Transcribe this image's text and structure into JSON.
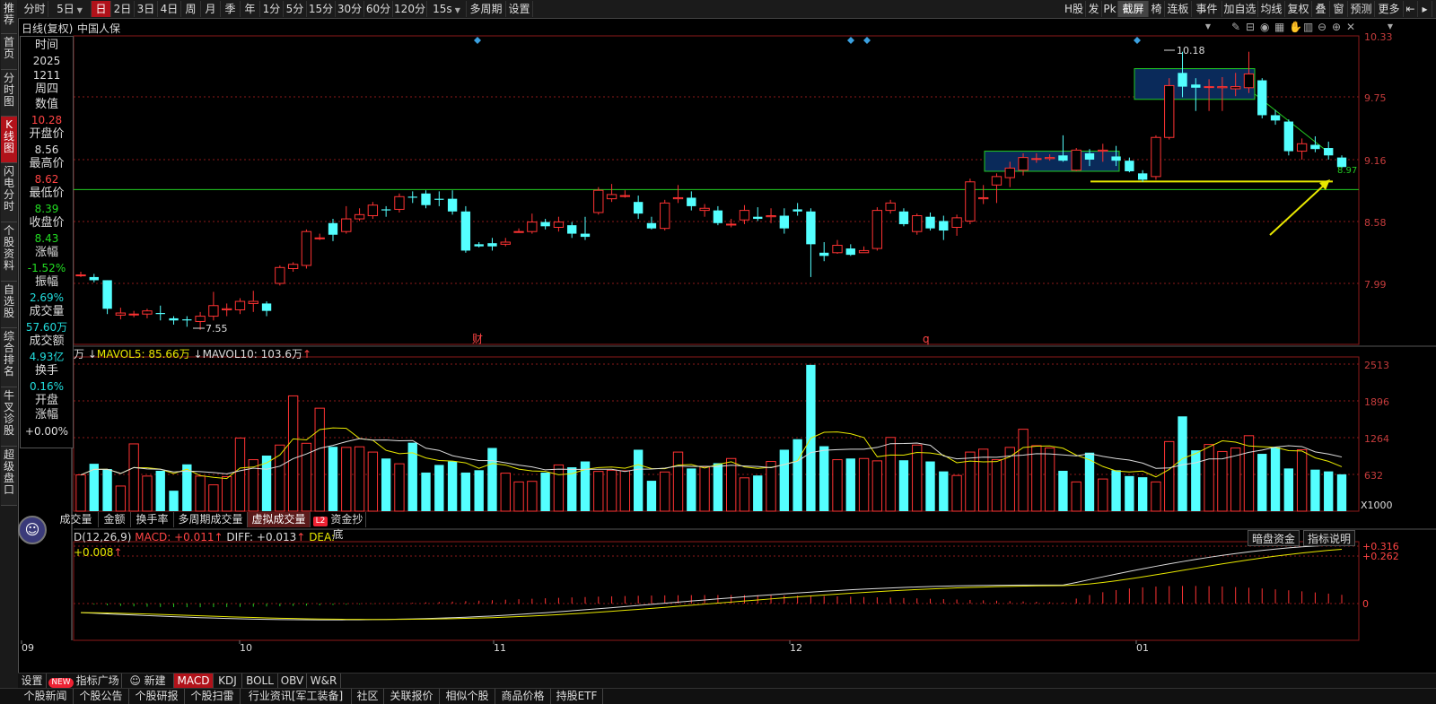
{
  "leftnav": [
    {
      "label": "推荐",
      "h": 38
    },
    {
      "label": "首页",
      "h": 40
    },
    {
      "label": "分时图",
      "h": 52
    },
    {
      "label": "K线图",
      "h": 52,
      "active": true
    },
    {
      "label": "闪电分时",
      "h": 66
    },
    {
      "label": "个股资料",
      "h": 66
    },
    {
      "label": "自选股",
      "h": 52
    },
    {
      "label": "综合排名",
      "h": 66
    },
    {
      "label": "牛叉诊股",
      "h": 66
    },
    {
      "label": "超级盘口",
      "h": 66
    }
  ],
  "toolbar": {
    "left": [
      {
        "label": "分时",
        "w": 30
      },
      {
        "label": "5日",
        "w": 48,
        "dropdown": true
      },
      {
        "label": "日",
        "w": 22,
        "selected": true
      },
      {
        "label": "2日",
        "w": 26
      },
      {
        "label": "3日",
        "w": 26
      },
      {
        "label": "4日",
        "w": 26
      },
      {
        "label": "周",
        "w": 22
      },
      {
        "label": "月",
        "w": 22
      },
      {
        "label": "季",
        "w": 22
      },
      {
        "label": "年",
        "w": 22
      },
      {
        "label": "1分",
        "w": 26
      },
      {
        "label": "5分",
        "w": 26
      },
      {
        "label": "15分",
        "w": 32
      },
      {
        "label": "30分",
        "w": 32
      },
      {
        "label": "60分",
        "w": 32
      },
      {
        "label": "120分",
        "w": 38
      },
      {
        "label": "15s",
        "w": 44,
        "dropdown": true
      },
      {
        "label": "多周期",
        "w": 44
      },
      {
        "label": "设置",
        "w": 30
      }
    ],
    "right": [
      {
        "label": "H股",
        "w": 26
      },
      {
        "label": "发",
        "w": 18
      },
      {
        "label": "Pk",
        "w": 18
      },
      {
        "label": "截屏",
        "w": 34,
        "dark": true
      },
      {
        "label": "椅",
        "w": 18
      },
      {
        "label": "连板",
        "w": 30
      },
      {
        "label": "事件",
        "w": 34,
        "dropdown": true
      },
      {
        "label": "加自选",
        "w": 40
      },
      {
        "label": "均线",
        "w": 30
      },
      {
        "label": "复权",
        "w": 30
      },
      {
        "label": "叠",
        "w": 20
      },
      {
        "label": "窗",
        "w": 20
      },
      {
        "label": "预测",
        "w": 30
      },
      {
        "label": "更多",
        "w": 32,
        "dropdown": true
      },
      {
        "label": "",
        "w": 16,
        "icon": "prev-icon"
      },
      {
        "label": "",
        "w": 16,
        "icon": "next-icon"
      }
    ]
  },
  "header": {
    "kline_type": "日线(复权)",
    "stock_name": "中国人保"
  },
  "data_panel": {
    "time_label": "时间",
    "time_year": "2025",
    "time_md": "1211",
    "weekday": "周四",
    "value_label": "数值",
    "value": "10.28",
    "open_label": "开盘价",
    "open": "8.56",
    "high_label": "最高价",
    "high": "8.62",
    "low_label": "最低价",
    "low": "8.39",
    "close_label": "收盘价",
    "close": "8.43",
    "change_label": "涨幅",
    "change": "-1.52%",
    "amplitude_label": "振幅",
    "amplitude": "2.69%",
    "volume_label": "成交量",
    "volume": "57.60万",
    "amount_label": "成交额",
    "amount": "4.93亿",
    "turnover_label": "换手",
    "turnover": "0.16%",
    "open_change_label_1": "开盘",
    "open_change_label_2": "涨幅",
    "open_change": "+0.00%"
  },
  "price_axis": [
    "10.33",
    "9.75",
    "9.16",
    "8.58",
    "7.99"
  ],
  "volume_axis": [
    "2513",
    "1896",
    "1264",
    "632"
  ],
  "volume_unit": "X1000",
  "macd_axis": [
    "+0.316",
    "+0.262",
    "0"
  ],
  "date_labels": [
    "09",
    "10",
    "11",
    "12",
    "01"
  ],
  "annotations": {
    "high": "10.18",
    "low": "7.55",
    "current": "8.97",
    "event_1": "财",
    "event_2": "q"
  },
  "volume_legend": {
    "prefix": "万",
    "mavol5": "MAVOL5: 85.66万",
    "mavol10": "MAVOL10: 103.6万"
  },
  "volume_tabs": [
    {
      "label": "成交量",
      "w": 50
    },
    {
      "label": "金额",
      "w": 36
    },
    {
      "label": "换手率",
      "w": 48
    },
    {
      "label": "多周期成交量",
      "w": 82
    },
    {
      "label": "虚拟成交量",
      "w": 70,
      "selected": true
    },
    {
      "label": "资金抄底",
      "w": 62,
      "badge": "L2"
    }
  ],
  "macd_legend": {
    "name": "D(12,26,9)",
    "macd": "MACD: +0.011",
    "diff": "DIFF: +0.013",
    "dea": "DEA: +0.008"
  },
  "macd_buttons": [
    "暗盘资金",
    "指标说明"
  ],
  "indicator_tabs": [
    {
      "label": "设置",
      "w": 32
    },
    {
      "label": "指标广场",
      "w": 84,
      "badge": "NEW"
    },
    {
      "label": "新建",
      "w": 58,
      "icon": "robot-icon"
    },
    {
      "label": "MACD",
      "w": 44,
      "selected": true
    },
    {
      "label": "KDJ",
      "w": 32
    },
    {
      "label": "BOLL",
      "w": 40
    },
    {
      "label": "OBV",
      "w": 32
    },
    {
      "label": "W&R",
      "w": 38
    }
  ],
  "footer_tabs": [
    {
      "label": "个股新闻",
      "w": 62
    },
    {
      "label": "个股公告",
      "w": 62
    },
    {
      "label": "个股研报",
      "w": 62
    },
    {
      "label": "个股扫雷",
      "w": 62
    },
    {
      "label": "行业资讯[军工装备]",
      "w": 124
    },
    {
      "label": "社区",
      "w": 36
    },
    {
      "label": "关联报价",
      "w": 62
    },
    {
      "label": "相似个股",
      "w": 62
    },
    {
      "label": "商品价格",
      "w": 62
    },
    {
      "label": "持股ETF",
      "w": 58
    }
  ],
  "colors": {
    "up": "#ff3333",
    "down": "#54ffff",
    "ma_white": "#dddddd",
    "ma_yellow": "#e8e800",
    "green_line": "#22cc22",
    "arrow": "#e8e800",
    "grid": "#8b1a1a"
  }
}
